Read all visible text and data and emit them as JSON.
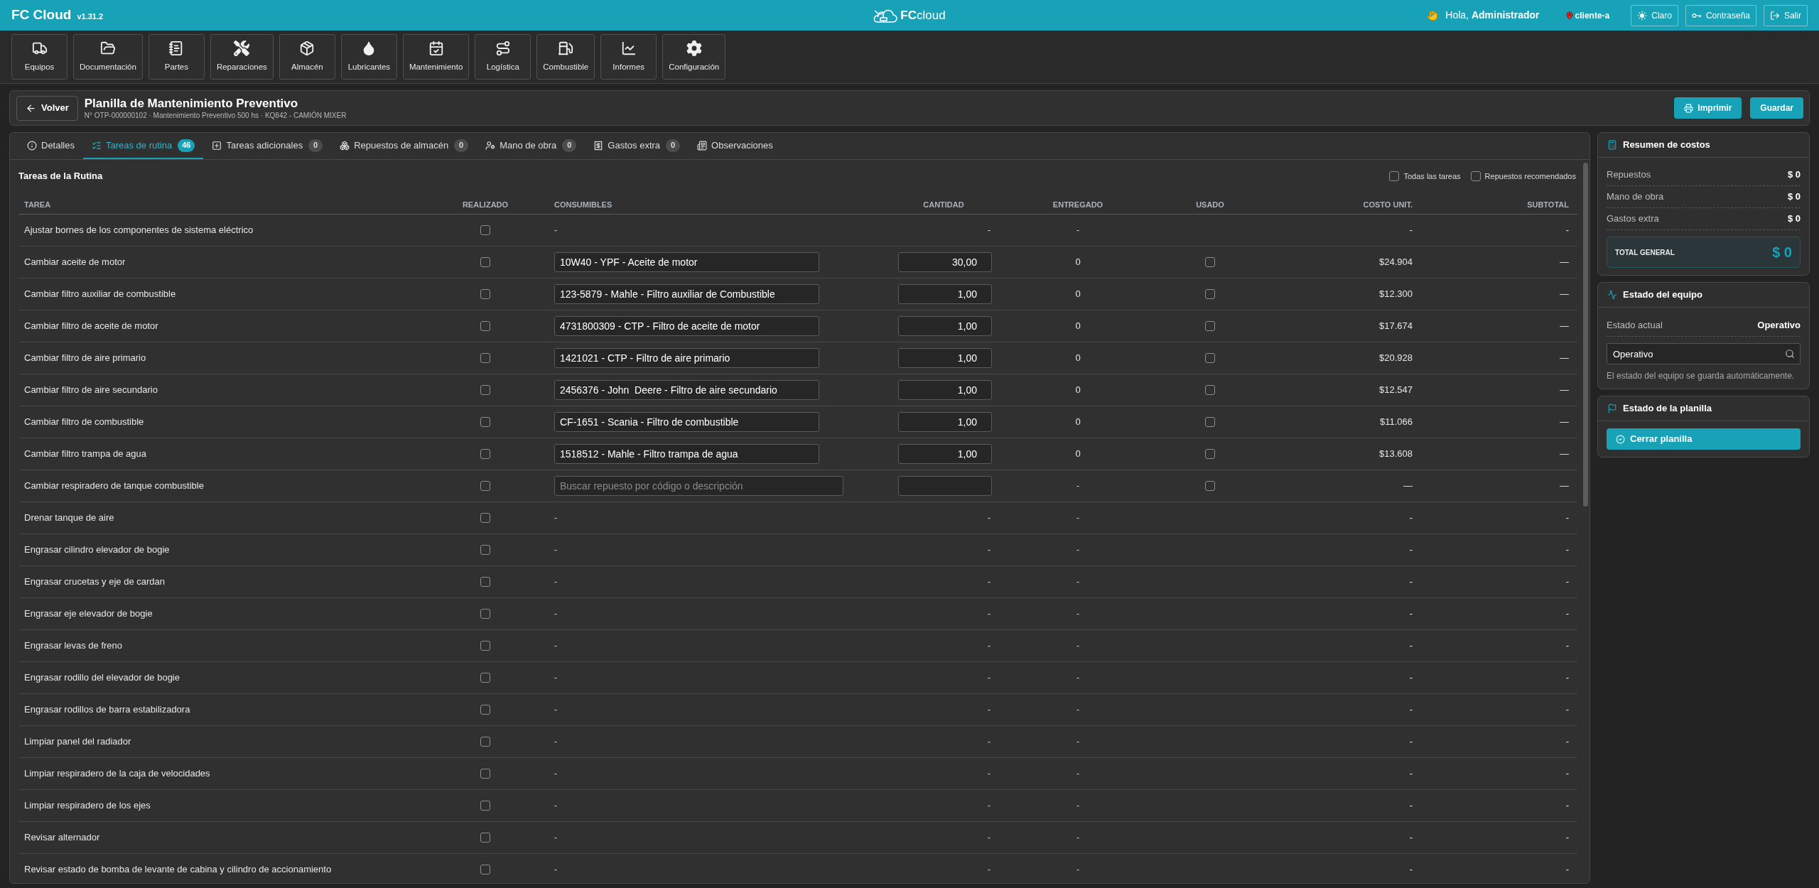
{
  "app": {
    "name": "FC Cloud",
    "version": "v1.31.2"
  },
  "logo": {
    "text": "**FC**cloud"
  },
  "user": {
    "greeting": "Hola, **Administrador**",
    "client": "cliente-a"
  },
  "header_buttons": [
    "Claro",
    "Contraseña",
    "Salir"
  ],
  "modules": [
    "Equipos",
    "Documentación",
    "Partes",
    "Reparaciones",
    "Almacén",
    "Lubricantes",
    "Mantenimiento",
    "Logística",
    "Combustible",
    "Informes",
    "Configuración"
  ],
  "page": {
    "back": "Volver",
    "title": "Planilla de Mantenimiento Preventivo",
    "subtitle": "N° OTP-000000102 · Mantenimiento Preventivo 500 hs · KQ842 - CAMIÓN MIXER",
    "actions": [
      "Imprimir",
      "Guardar"
    ]
  },
  "tabs": [
    {
      "label": "Detalles",
      "selected": false
    },
    {
      "label": "Tareas de rutina",
      "selected": true,
      "count": "46"
    },
    {
      "label": "Tareas adicionales",
      "selected": false,
      "count": "0"
    },
    {
      "label": "Repuestos de almacén",
      "selected": false,
      "count": "0"
    },
    {
      "label": "Mano de obra",
      "selected": false,
      "count": "0"
    },
    {
      "label": "Gastos extra",
      "selected": false,
      "count": "0"
    },
    {
      "label": "Observaciones",
      "selected": false
    }
  ],
  "section": {
    "title": "Tareas de la Rutina",
    "filters": [
      {
        "label": "Todas las tareas",
        "checked": false
      },
      {
        "label": "Repuestos recomendados",
        "checked": false
      }
    ]
  },
  "table": {
    "columns": [
      "TAREA",
      "REALIZADO",
      "CONSUMIBLES",
      "CANTIDAD",
      "ENTREGADO",
      "USADO",
      "COSTO UNIT.",
      "SUBTOTAL"
    ],
    "rows": [
      {
        "kind": "none",
        "task": "Ajustar bornes de los componentes de sistema eléctrico",
        "done": false,
        "consumables": "-",
        "quantity": "-",
        "delivered": "-",
        "unit_cost": "-",
        "subtotal": "-"
      },
      {
        "kind": "part",
        "task": "Cambiar aceite de motor",
        "done": false,
        "consumable": "10W40 - YPF - Aceite de motor",
        "quantity": "30,00",
        "delivered": "0",
        "used": false,
        "unit_cost": "$24.904",
        "subtotal": "—"
      },
      {
        "kind": "part",
        "task": "Cambiar filtro auxiliar de combustible",
        "done": false,
        "consumable": "123-5879 - Mahle - Filtro auxiliar de Combustible",
        "quantity": "1,00",
        "delivered": "0",
        "used": false,
        "unit_cost": "$12.300",
        "subtotal": "—"
      },
      {
        "kind": "part",
        "task": "Cambiar filtro de aceite de motor",
        "done": false,
        "consumable": "4731800309 - CTP - Filtro de aceite de motor",
        "quantity": "1,00",
        "delivered": "0",
        "used": false,
        "unit_cost": "$17.674",
        "subtotal": "—"
      },
      {
        "kind": "part",
        "task": "Cambiar filtro de aire primario",
        "done": false,
        "consumable": "1421021 - CTP - Filtro de aire primario",
        "quantity": "1,00",
        "delivered": "0",
        "used": false,
        "unit_cost": "$20.928",
        "subtotal": "—"
      },
      {
        "kind": "part",
        "task": "Cambiar filtro de aire secundario",
        "done": false,
        "consumable": "2456376 - John  Deere - Filtro de aire secundario",
        "quantity": "1,00",
        "delivered": "0",
        "used": false,
        "unit_cost": "$12.547",
        "subtotal": "—"
      },
      {
        "kind": "part",
        "task": "Cambiar filtro de combustible",
        "done": false,
        "consumable": "CF-1651 - Scania - Filtro de combustible",
        "quantity": "1,00",
        "delivered": "0",
        "used": false,
        "unit_cost": "$11.066",
        "subtotal": "—"
      },
      {
        "kind": "part",
        "task": "Cambiar filtro trampa de agua",
        "done": false,
        "consumable": "1518512 - Mahle - Filtro trampa de agua",
        "quantity": "1,00",
        "delivered": "0",
        "used": false,
        "unit_cost": "$13.608",
        "subtotal": "—"
      },
      {
        "kind": "search",
        "task": "Cambiar respiradero de tanque combustible",
        "done": false,
        "placeholder": "Buscar repuesto por código o descripción",
        "delivered": "-",
        "used": false,
        "unit_cost": "—",
        "subtotal": "—"
      },
      {
        "kind": "none",
        "task": "Drenar tanque de aire",
        "done": false,
        "consumables": "-",
        "quantity": "-",
        "delivered": "-",
        "unit_cost": "-",
        "subtotal": "-"
      },
      {
        "kind": "none",
        "task": "Engrasar cilindro elevador de bogie",
        "done": false,
        "consumables": "-",
        "quantity": "-",
        "delivered": "-",
        "unit_cost": "-",
        "subtotal": "-"
      },
      {
        "kind": "none",
        "task": "Engrasar crucetas y eje de cardan",
        "done": false,
        "consumables": "-",
        "quantity": "-",
        "delivered": "-",
        "unit_cost": "-",
        "subtotal": "-"
      },
      {
        "kind": "none",
        "task": "Engrasar eje elevador de bogie",
        "done": false,
        "consumables": "-",
        "quantity": "-",
        "delivered": "-",
        "unit_cost": "-",
        "subtotal": "-"
      },
      {
        "kind": "none",
        "task": "Engrasar levas de freno",
        "done": false,
        "consumables": "-",
        "quantity": "-",
        "delivered": "-",
        "unit_cost": "-",
        "subtotal": "-"
      },
      {
        "kind": "none",
        "task": "Engrasar rodillo del elevador de bogie",
        "done": false,
        "consumables": "-",
        "quantity": "-",
        "delivered": "-",
        "unit_cost": "-",
        "subtotal": "-"
      },
      {
        "kind": "none",
        "task": "Engrasar rodillos de barra estabilizadora",
        "done": false,
        "consumables": "-",
        "quantity": "-",
        "delivered": "-",
        "unit_cost": "-",
        "subtotal": "-"
      },
      {
        "kind": "none",
        "task": "Limpiar panel del radiador",
        "done": false,
        "consumables": "-",
        "quantity": "-",
        "delivered": "-",
        "unit_cost": "-",
        "subtotal": "-"
      },
      {
        "kind": "none",
        "task": "Limpiar respiradero de la caja de velocidades",
        "done": false,
        "consumables": "-",
        "quantity": "-",
        "delivered": "-",
        "unit_cost": "-",
        "subtotal": "-"
      },
      {
        "kind": "none",
        "task": "Limpiar respiradero de los ejes",
        "done": false,
        "consumables": "-",
        "quantity": "-",
        "delivered": "-",
        "unit_cost": "-",
        "subtotal": "-"
      },
      {
        "kind": "none",
        "task": "Revisar alternador",
        "done": false,
        "consumables": "-",
        "quantity": "-",
        "delivered": "-",
        "unit_cost": "-",
        "subtotal": "-"
      },
      {
        "kind": "none",
        "task": "Revisar estado de bomba de levante de cabina y cilindro de accionamiento",
        "done": false,
        "consumables": "-",
        "quantity": "-",
        "delivered": "-",
        "unit_cost": "-",
        "subtotal": "-"
      }
    ]
  },
  "cost_summary": {
    "title": "Resumen de costos",
    "rows": [
      {
        "label": "Repuestos",
        "value": "$ 0"
      },
      {
        "label": "Mano de obra",
        "value": "$ 0"
      },
      {
        "label": "Gastos extra",
        "value": "$ 0"
      }
    ],
    "total": {
      "label": "TOTAL GENERAL",
      "value": "$ 0"
    }
  },
  "equipment_status": {
    "title": "Estado del equipo",
    "current_label": "Estado actual",
    "current_value": "Operativo",
    "select_value": "Operativo",
    "hint": "El estado del equipo se guarda automáticamente."
  },
  "sheet_status": {
    "title": "Estado de la planilla",
    "button": "Cerrar planilla"
  }
}
